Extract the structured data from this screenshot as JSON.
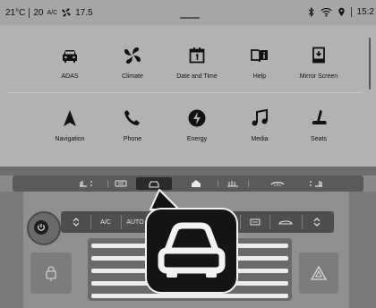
{
  "status_bar": {
    "temperature": "21°C",
    "value_a": "20",
    "ac_label": "A/C",
    "fan_level": "17.5",
    "time": "15:2"
  },
  "icons": {
    "bluetooth": "bluetooth-icon",
    "wifi": "wifi-icon",
    "location": "location-pin-icon"
  },
  "apps": [
    {
      "label": "ADAS",
      "icon": "car-icon"
    },
    {
      "label": "Climate",
      "icon": "fan-icon"
    },
    {
      "label": "Date and Time",
      "icon": "calendar-icon"
    },
    {
      "label": "Help",
      "icon": "book-info-icon"
    },
    {
      "label": "Mirror Screen",
      "icon": "phone-mirror-icon"
    },
    {
      "label": "Navigation",
      "icon": "navigation-arrow-icon"
    },
    {
      "label": "Phone",
      "icon": "phone-icon"
    },
    {
      "label": "Energy",
      "icon": "bolt-icon"
    },
    {
      "label": "Media",
      "icon": "music-note-icon"
    },
    {
      "label": "Seats",
      "icon": "seat-icon"
    }
  ],
  "climate_buttons": {
    "ac": "A/C",
    "auto": "AUTO"
  },
  "colors": {
    "screen_bg": "#b2b2b2",
    "callout_bg": "#141414",
    "panel": "#909090"
  }
}
